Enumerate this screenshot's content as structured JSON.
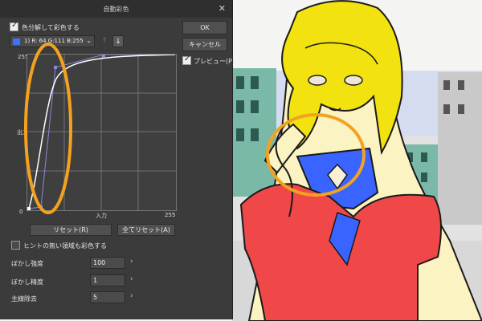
{
  "dialog": {
    "title": "自動彩色",
    "separate_colors_label": "色分解して彩色する",
    "color_selector": "1) R: 64 G:111 B:255",
    "swatch_color": "#4070ff",
    "ok_label": "OK",
    "cancel_label": "キャンセル",
    "preview_label": "プレビュー(P)",
    "graph": {
      "y_max": "255",
      "x_max": "255",
      "y_min": "0",
      "y_axis_label": "出力",
      "x_axis_label": "入力"
    },
    "reset_label": "リセット(R)",
    "reset_all_label": "全てリセット(A)",
    "no_line_area_label": "ヒントの無い領域も彩色する",
    "params": [
      {
        "label": "ぼかし強度",
        "value": "100"
      },
      {
        "label": "ぼかし精度",
        "value": "1"
      },
      {
        "label": "主線除去",
        "value": "5"
      }
    ]
  }
}
